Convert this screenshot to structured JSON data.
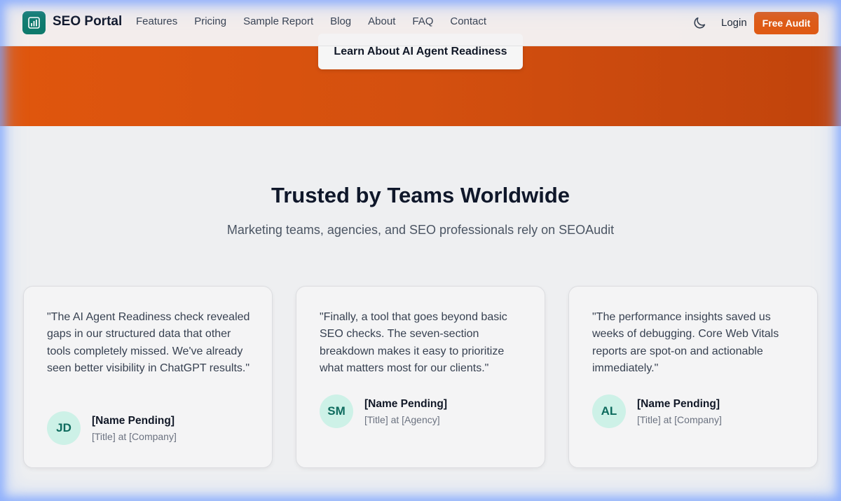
{
  "nav": {
    "brand": "SEO Portal",
    "links": [
      "Features",
      "Pricing",
      "Sample Report",
      "Blog",
      "About",
      "FAQ",
      "Contact"
    ],
    "login": "Login",
    "cta": "Free Audit",
    "logo_icon": "bar-chart-icon",
    "theme_icon": "moon-icon"
  },
  "hero": {
    "button": "Learn About AI Agent Readiness",
    "accent_color": "#df5a14"
  },
  "testimonials": {
    "title": "Trusted by Teams Worldwide",
    "subtitle": "Marketing teams, agencies, and SEO professionals rely on SEOAudit",
    "items": [
      {
        "quote": "\"The AI Agent Readiness check revealed gaps in our structured data that other tools completely missed. We've already seen better visibility in ChatGPT results.\"",
        "initials": "JD",
        "name": "[Name Pending]",
        "role": "[Title] at [Company]"
      },
      {
        "quote": "\"Finally, a tool that goes beyond basic SEO checks. The seven-section breakdown makes it easy to prioritize what matters most for our clients.\"",
        "initials": "SM",
        "name": "[Name Pending]",
        "role": "[Title] at [Agency]"
      },
      {
        "quote": "\"The performance insights saved us weeks of debugging. Core Web Vitals reports are spot-on and actionable immediately.\"",
        "initials": "AL",
        "name": "[Name Pending]",
        "role": "[Title] at [Company]"
      }
    ]
  }
}
